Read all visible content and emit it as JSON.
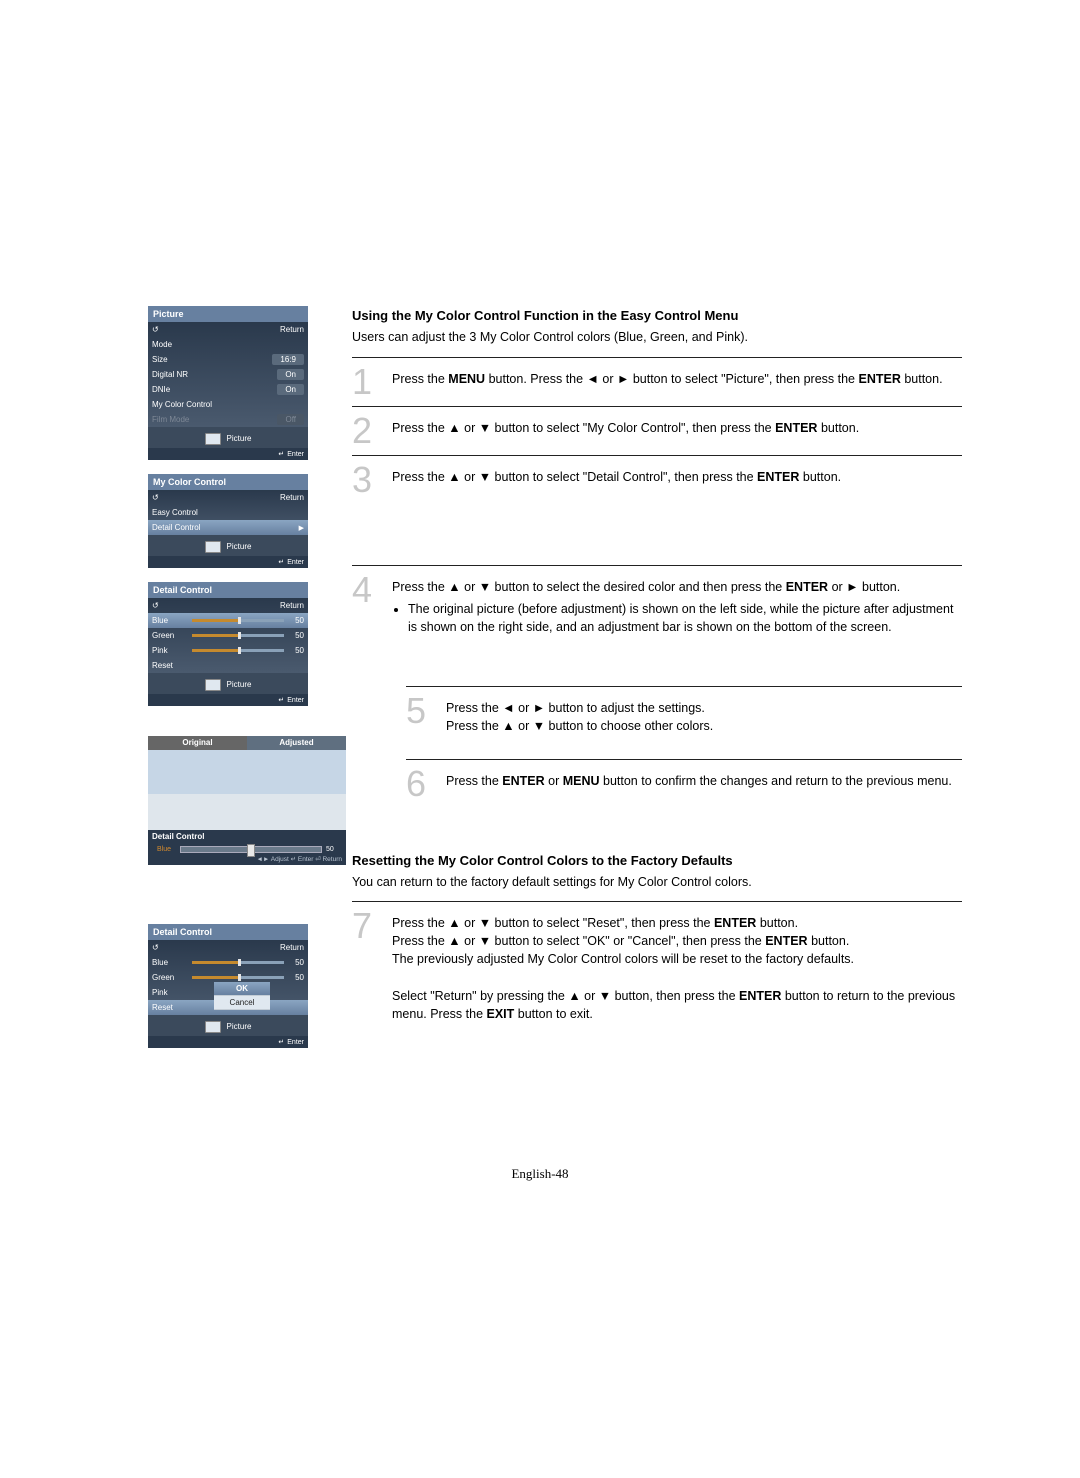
{
  "sidebar": {
    "picture_menu": {
      "title": "Picture",
      "return": "Return",
      "rows": [
        {
          "label": "Mode",
          "value": ""
        },
        {
          "label": "Size",
          "value": "16:9"
        },
        {
          "label": "Digital NR",
          "value": "On"
        },
        {
          "label": "DNIe",
          "value": "On"
        },
        {
          "label": "My Color Control",
          "value": ""
        },
        {
          "label": "Film Mode",
          "value": "Off",
          "dim": true
        }
      ],
      "pict_label": "Picture",
      "enter": "Enter"
    },
    "mcc_menu": {
      "title": "My Color Control",
      "return": "Return",
      "rows": [
        {
          "label": "Easy Control"
        },
        {
          "label": "Detail Control",
          "sel": true
        }
      ],
      "pict_label": "Picture",
      "enter": "Enter"
    },
    "detail_menu": {
      "title": "Detail Control",
      "return": "Return",
      "sliders": [
        {
          "label": "Blue",
          "value": "50",
          "sel": true
        },
        {
          "label": "Green",
          "value": "50"
        },
        {
          "label": "Pink",
          "value": "50"
        }
      ],
      "reset": "Reset",
      "pict_label": "Picture",
      "enter": "Enter"
    },
    "compare": {
      "original": "Original",
      "adjusted": "Adjusted",
      "ctrl_title": "Detail Control",
      "bar_label": "Blue",
      "bar_value": "50",
      "hint": "◄► Adjust  ↵ Enter  ⏎ Return"
    },
    "reset_menu": {
      "title": "Detail Control",
      "return": "Return",
      "sliders": [
        {
          "label": "Blue",
          "value": "50"
        },
        {
          "label": "Green",
          "value": "50"
        }
      ],
      "pink": "Pink",
      "reset": "Reset",
      "ok": "OK",
      "cancel": "Cancel",
      "pict_label": "Picture",
      "enter": "Enter"
    }
  },
  "main": {
    "sec1": {
      "title": "Using the My Color Control Function in the Easy Control Menu",
      "intro": "Users can adjust the 3 My Color Control colors (Blue, Green, and Pink).",
      "step1": {
        "n": "1",
        "a": "Press the ",
        "b1": "MENU",
        "b": " button. Press the  ◄  or  ►  button to select \"Picture\", then press the ",
        "b2": "ENTER",
        "c": " button."
      },
      "step2": {
        "n": "2",
        "a": "Press the  ▲  or  ▼  button to select \"My Color Control\", then press the ",
        "b1": "ENTER",
        "b": " button."
      },
      "step3": {
        "n": "3",
        "a": "Press the  ▲  or  ▼  button to select \"Detail Control\", then press the ",
        "b1": "ENTER",
        "b": " button."
      },
      "step4": {
        "n": "4",
        "a": "Press the  ▲  or  ▼  button to select the desired color and then press the ",
        "b1": "ENTER",
        "b": " or  ►  button.",
        "bullet": "The original picture (before adjustment) is shown on the left side, while the picture after adjustment is shown on the right side, and an adjustment bar is shown on the bottom of the screen."
      },
      "step5": {
        "n": "5",
        "a": "Press the  ◄  or  ►  button to adjust the settings.",
        "b": "Press the  ▲  or  ▼   button to choose other colors."
      },
      "step6": {
        "n": "6",
        "a": "Press the ",
        "b1": "ENTER",
        "b": " or ",
        "b2": "MENU",
        "c": " button to confirm the changes and return to the previous menu."
      }
    },
    "sec2": {
      "title": "Resetting the My Color Control Colors to the Factory Defaults",
      "intro": "You can return to the factory default settings for My Color Control colors.",
      "step7": {
        "n": "7",
        "a": "Press the  ▲  or  ▼  button to select \"Reset\", then press the ",
        "b1": "ENTER",
        "b": " button.",
        "c": "Press the  ▲  or  ▼  button to select \"OK\" or \"Cancel\", then press the ",
        "b2": "ENTER",
        "d": " button.",
        "e": "The previously adjusted My Color Control colors will be reset to the factory defaults.",
        "f": "Select \"Return\" by pressing the  ▲  or  ▼  button, then press the ",
        "b3": "ENTER",
        "g": " button to return to the previous menu. Press the ",
        "b4": "EXIT",
        "h": " button to exit."
      }
    }
  },
  "page_footer": "English-48"
}
